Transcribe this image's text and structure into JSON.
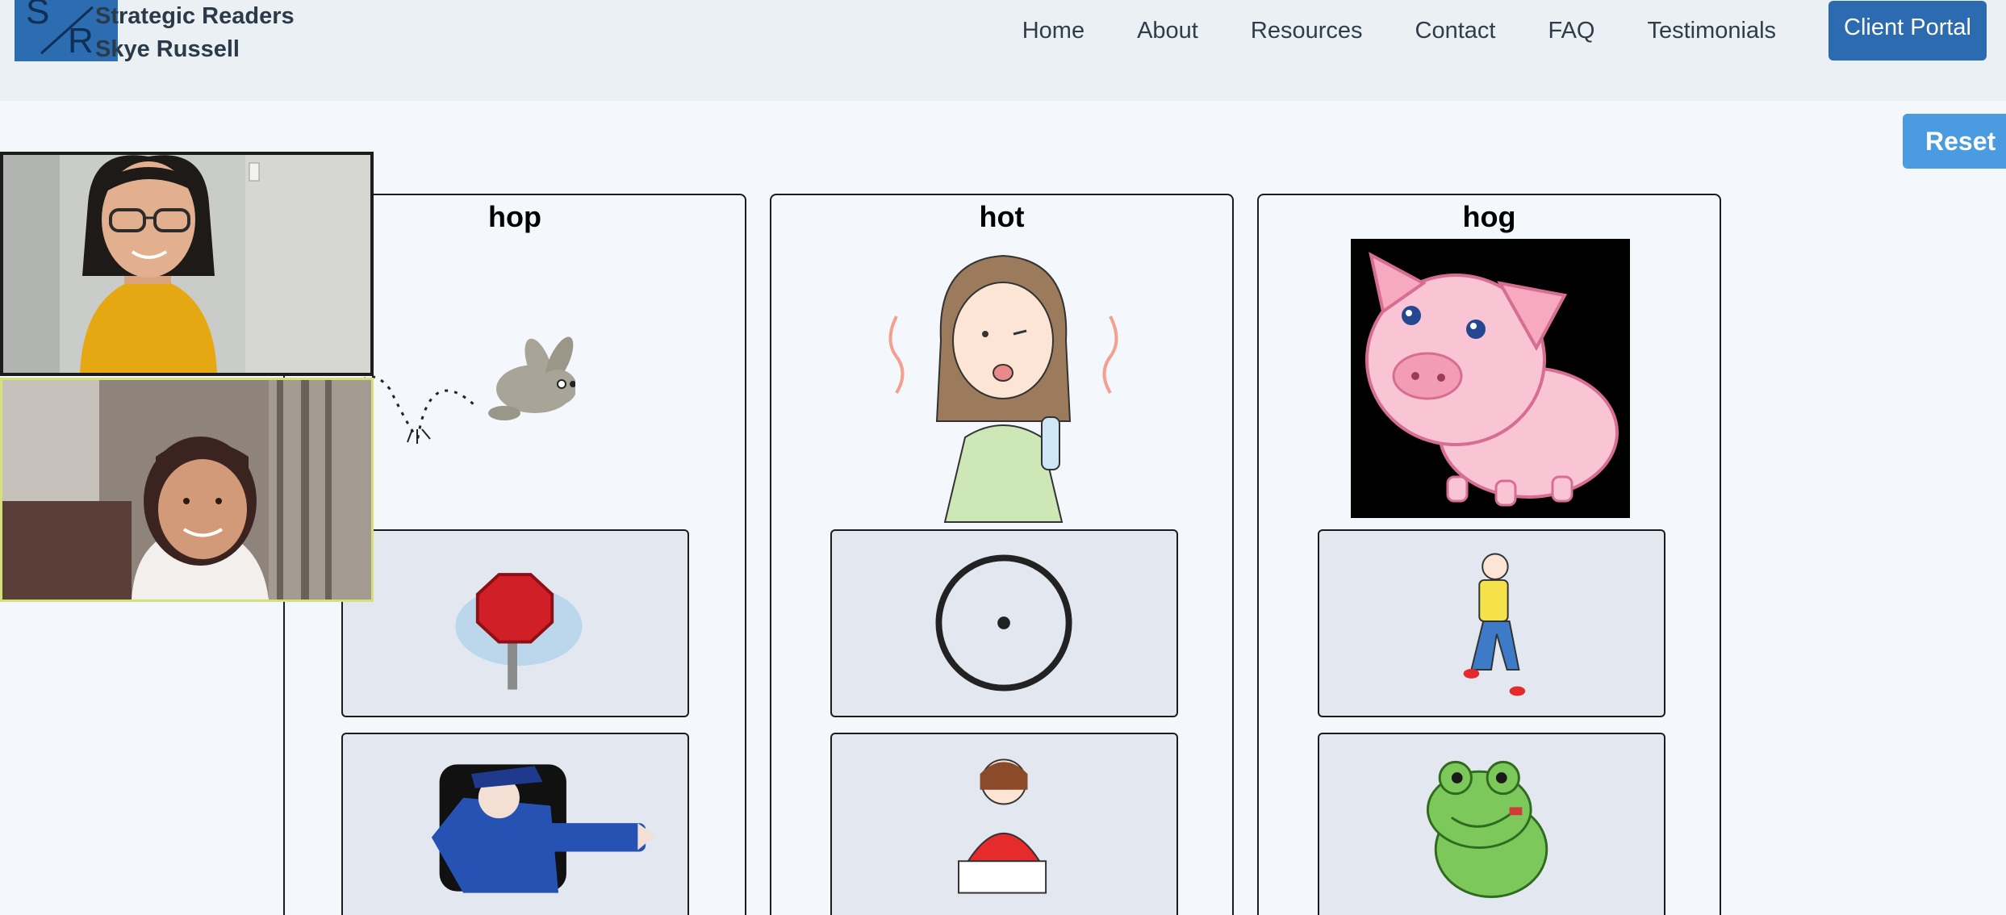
{
  "header": {
    "brand_line1": "Strategic Readers",
    "brand_line2": "Skye Russell",
    "logo_top": "S",
    "logo_bottom": "R",
    "nav": [
      "Home",
      "About",
      "Resources",
      "Contact",
      "FAQ",
      "Testimonials"
    ],
    "portal_label": "Client Portal"
  },
  "reset_label": "Reset",
  "columns": [
    {
      "word": "hop",
      "hero": "hopping-bunny",
      "cards": [
        "stop-sign",
        "police-officer"
      ]
    },
    {
      "word": "hot",
      "hero": "hot-girl",
      "cards": [
        "dot",
        "writing-girl"
      ]
    },
    {
      "word": "hog",
      "hero": "pig",
      "cards": [
        "jogging-man",
        "frog"
      ]
    }
  ],
  "colors": {
    "accent": "#2c6bb0",
    "reset": "#4a9be0",
    "background": "#f4f8fc",
    "header": "#ebf0f5",
    "card": "#e3e8f0"
  },
  "video_tiles": [
    "tutor-video",
    "student-video"
  ]
}
